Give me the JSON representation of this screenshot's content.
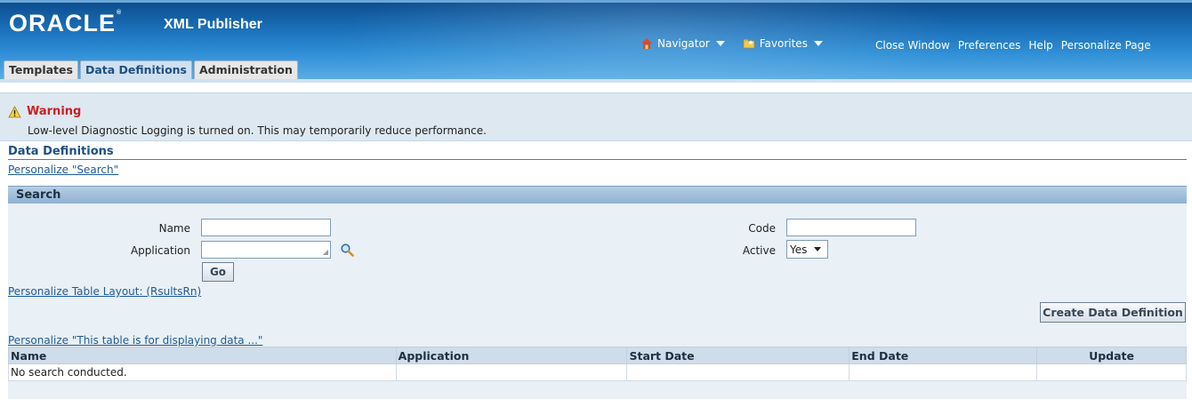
{
  "header": {
    "logo_text": "ORACLE",
    "app_title": "XML Publisher",
    "menus": [
      {
        "label": "Navigator",
        "icon": "home-icon"
      },
      {
        "label": "Favorites",
        "icon": "favorites-folder-icon"
      }
    ],
    "links": [
      "Close Window",
      "Preferences",
      "Help",
      "Personalize Page"
    ],
    "tabs": [
      {
        "label": "Templates",
        "active": false
      },
      {
        "label": "Data Definitions",
        "active": true
      },
      {
        "label": "Administration",
        "active": false
      }
    ]
  },
  "warning": {
    "title": "Warning",
    "message": "Low-level Diagnostic Logging is turned on. This may temporarily reduce performance.",
    "icon": "warning-triangle-icon"
  },
  "page": {
    "title": "Data Definitions",
    "personalize_search": "Personalize \"Search\"",
    "personalize_table": "Personalize Table Layout: (RsultsRn)",
    "personalize_data": "Personalize \"This table is for displaying data ...\""
  },
  "search": {
    "header": "Search",
    "name_label": "Name",
    "name_value": "",
    "application_label": "Application",
    "application_value": "",
    "code_label": "Code",
    "code_value": "",
    "active_label": "Active",
    "active_value": "Yes",
    "go_label": "Go",
    "lookup_icon": "search-magnifier-icon"
  },
  "actions": {
    "create_label": "Create Data Definition"
  },
  "table": {
    "columns": [
      "Name",
      "Application",
      "Start Date",
      "End Date",
      "Update"
    ],
    "empty_message": "No search conducted."
  },
  "colors": {
    "accent": "#1e5b94",
    "header_bar": "#8eb2d3",
    "warning_text": "#cc1f1f"
  }
}
